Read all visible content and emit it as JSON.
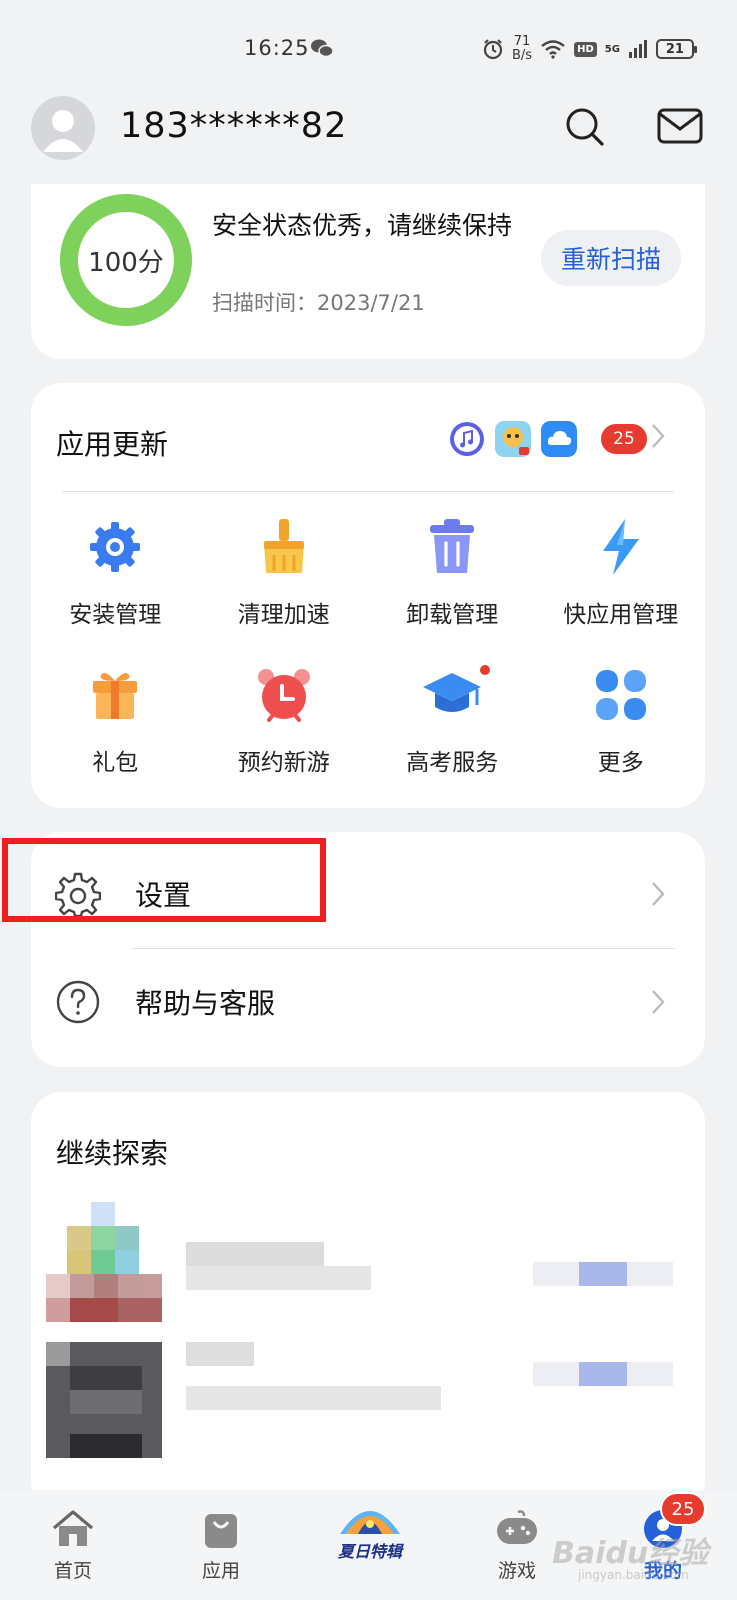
{
  "status_bar": {
    "time": "16:25",
    "net_speed_value": "71",
    "net_speed_unit": "B/s",
    "hd": "HD",
    "network": "5G",
    "battery": "21"
  },
  "header": {
    "phone_number": "183******82"
  },
  "security": {
    "score": 100,
    "score_label": "100分",
    "status_text": "安全状态优秀，请继续保持",
    "scan_time": "扫描时间：2023/7/21",
    "rescan_label": "重新扫描"
  },
  "app_update": {
    "title": "应用更新",
    "count": "25",
    "thumbs": [
      "music-app-icon",
      "game-app-icon",
      "cloud-app-icon"
    ]
  },
  "tools": [
    {
      "label": "安装管理",
      "icon": "install-gear-icon"
    },
    {
      "label": "清理加速",
      "icon": "broom-icon"
    },
    {
      "label": "卸载管理",
      "icon": "trash-icon"
    },
    {
      "label": "快应用管理",
      "icon": "lightning-icon"
    },
    {
      "label": "礼包",
      "icon": "gift-icon"
    },
    {
      "label": "预约新游",
      "icon": "alarm-clock-icon"
    },
    {
      "label": "高考服务",
      "icon": "graduation-cap-icon"
    },
    {
      "label": "更多",
      "icon": "grid-more-icon"
    }
  ],
  "settings_list": {
    "settings_label": "设置",
    "help_label": "帮助与客服"
  },
  "explore": {
    "title": "继续探索"
  },
  "tab_bar": {
    "tabs": [
      {
        "label": "首页",
        "icon": "home-icon"
      },
      {
        "label": "应用",
        "icon": "shopping-bag-icon"
      },
      {
        "label": "夏日特辑",
        "icon": "summer-banner-icon"
      },
      {
        "label": "游戏",
        "icon": "gamepad-icon"
      },
      {
        "label": "我的",
        "icon": "profile-icon"
      }
    ],
    "badge": "25"
  },
  "watermark": {
    "text": "Baidu经验",
    "sub": "jingyan.baidu.com"
  },
  "colors": {
    "accent": "#2560d9",
    "badge_red": "#e63b2e",
    "ring_green": "#7ed15a",
    "highlight_red": "#f01e1e"
  }
}
